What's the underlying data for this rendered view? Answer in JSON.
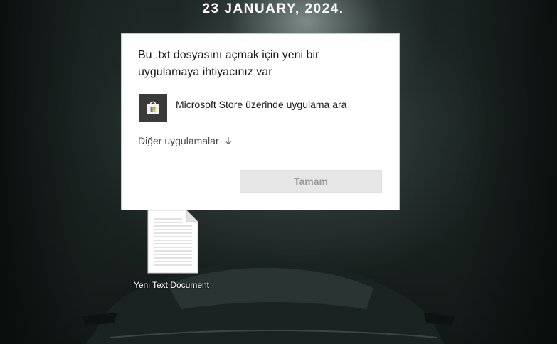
{
  "desktop": {
    "date_text": "23 JANUARY, 2024."
  },
  "dialog": {
    "title": "Bu .txt dosyasını açmak için yeni bir uygulamaya ihtiyacınız var",
    "store_option_label": "Microsoft Store üzerinde uygulama ara",
    "more_apps_label": "Diğer uygulamalar",
    "ok_label": "Tamam"
  },
  "desktop_icons": [
    {
      "label": "Yeni Text Document",
      "icon": "text-document-icon"
    }
  ],
  "colors": {
    "dialog_bg": "#ffffff",
    "button_disabled_bg": "#e6e6e6",
    "button_disabled_text": "#9a9a9a",
    "store_tile_bg": "#3a3a3a"
  }
}
